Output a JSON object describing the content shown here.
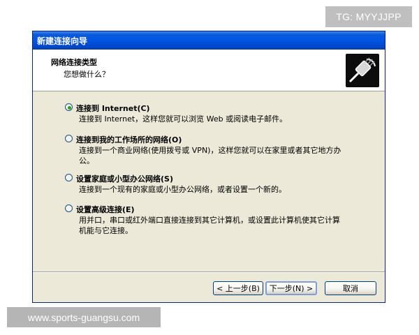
{
  "watermarks": {
    "tag": "TG: MYYJJPP",
    "site": "www.sports-guangsu.com"
  },
  "window": {
    "title": "新建连接向导",
    "header": {
      "title": "网络连接类型",
      "subtitle": "您想做什么？",
      "icon": "network-cable-icon"
    },
    "options": [
      {
        "label": "连接到 Internet(C)",
        "description": "连接到 Internet，这样您就可以浏览 Web 或阅读电子邮件。",
        "selected": true
      },
      {
        "label": "连接到我的工作场所的网络(O)",
        "description": "连接到一个商业网络(使用拨号或 VPN)，这样您就可以在家里或者其它地方办公。",
        "selected": false
      },
      {
        "label": "设置家庭或小型办公网络(S)",
        "description": "连接到一个现有的家庭或小型办公网络，或者设置一个新的。",
        "selected": false
      },
      {
        "label": "设置高级连接(E)",
        "description": "用并口，串口或红外端口直接连接到其它计算机，或设置此计算机使其它计算机能与它连接。",
        "selected": false
      }
    ],
    "buttons": {
      "back": "< 上一步(B)",
      "next": "下一步(N) >",
      "cancel": "取消"
    },
    "colors": {
      "titlebar": "#0054e3",
      "dialog_bg": "#ece9d8",
      "radio_selected": "#21a121"
    }
  }
}
